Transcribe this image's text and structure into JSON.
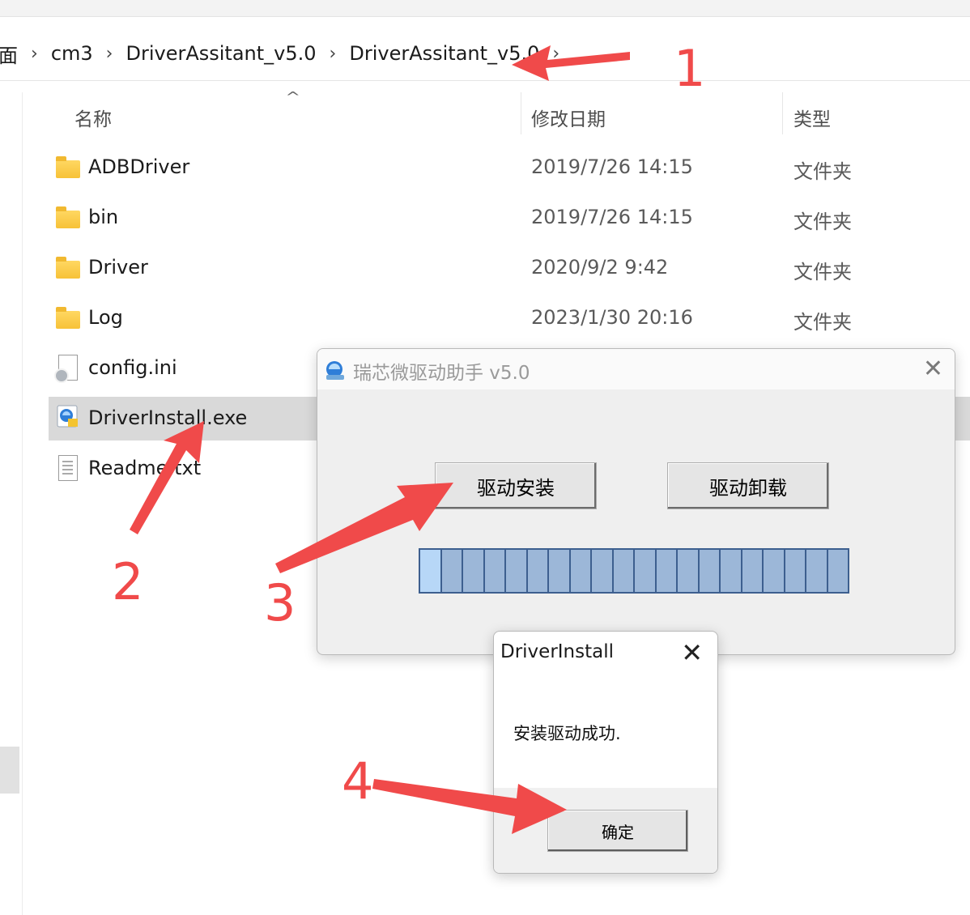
{
  "breadcrumb": {
    "items": [
      "面",
      "cm3",
      "DriverAssitant_v5.0",
      "DriverAssitant_v5.0"
    ],
    "separator": "›"
  },
  "columns": {
    "name": "名称",
    "modified": "修改日期",
    "type": "类型"
  },
  "files": [
    {
      "name": "ADBDriver",
      "date": "2019/7/26 14:15",
      "type": "文件夹",
      "icon": "folder-icon"
    },
    {
      "name": "bin",
      "date": "2019/7/26 14:15",
      "type": "文件夹",
      "icon": "folder-icon"
    },
    {
      "name": "Driver",
      "date": "2020/9/2 9:42",
      "type": "文件夹",
      "icon": "folder-icon"
    },
    {
      "name": "Log",
      "date": "2023/1/30 20:16",
      "type": "文件夹",
      "icon": "folder-icon"
    },
    {
      "name": "config.ini",
      "icon": "settings-file-icon"
    },
    {
      "name": "DriverInstall.exe",
      "icon": "exe-file-icon",
      "selected": true
    },
    {
      "name": "Readme.txt",
      "icon": "text-file-icon"
    }
  ],
  "app_dialog": {
    "title": "瑞芯微驱动助手 v5.0",
    "install_label": "驱动安装",
    "uninstall_label": "驱动卸载",
    "progress_segments": 20,
    "close_glyph": "✕"
  },
  "message_box": {
    "title": "DriverInstall",
    "text": "安装驱动成功.",
    "ok_label": "确定",
    "close_glyph": "✕"
  },
  "annotations": {
    "step1": "1",
    "step2": "2",
    "step3": "3",
    "step4": "4",
    "color": "#f04a4a"
  },
  "colors": {
    "selection": "#d9d9d9",
    "progress_fill": "#9cb7d8",
    "progress_border": "#3d5f8f"
  }
}
